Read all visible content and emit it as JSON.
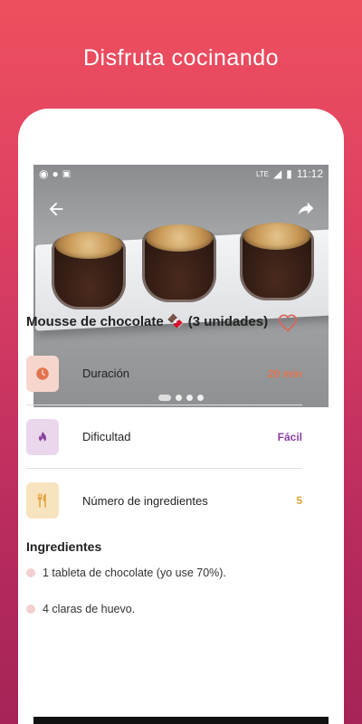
{
  "promo": {
    "title": "Disfruta cocinando"
  },
  "status": {
    "time": "11:12",
    "network": "LTE"
  },
  "recipe": {
    "title": "Mousse de chocolate 🍫 (3 unidades)",
    "carousel_pages": 5
  },
  "info": [
    {
      "label": "Duración",
      "value": "20 min",
      "icon": "timer-icon",
      "color": "#e3734e",
      "bg": "#f6d6cc"
    },
    {
      "label": "Dificultad",
      "value": "Fácil",
      "icon": "flame-icon",
      "color": "#8a3f9e",
      "bg": "#ead7ec"
    },
    {
      "label": "Número de ingredientes",
      "value": "5",
      "icon": "cutlery-icon",
      "color": "#e0a23a",
      "bg": "#f8e3bf"
    }
  ],
  "ingredients": {
    "heading": "Ingredientes",
    "items": [
      "1 tableta de chocolate (yo use 70%).",
      "4 claras de huevo."
    ]
  },
  "colors": {
    "accent": "#d94f3f"
  }
}
